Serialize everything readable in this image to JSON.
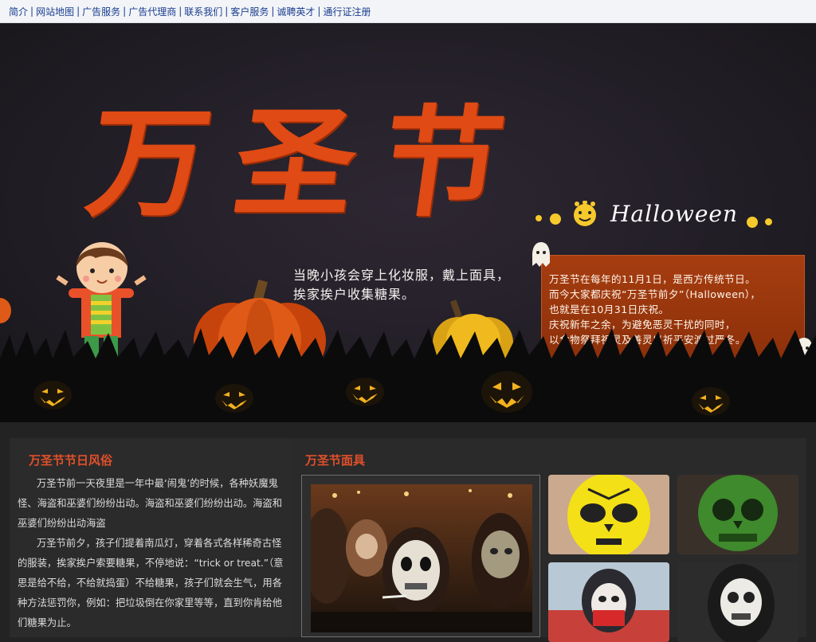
{
  "nav": {
    "items": [
      "简介",
      "网站地图",
      "广告服务",
      "广告代理商",
      "联系我们",
      "客户服务",
      "诚聘英才",
      "通行证注册"
    ],
    "separator": "|"
  },
  "banner": {
    "title": "万圣节",
    "halloween": "Halloween",
    "subtitle_line1": "当晚小孩会穿上化妆服，戴上面具，",
    "subtitle_line2": "挨家挨户收集糖果。",
    "box_lines": [
      "万圣节在每年的11月1日，是西方传统节日。",
      "而今大家都庆祝“万圣节前夕”（Halloween），",
      "也就是在10月31日庆祝。",
      "庆祝新年之余，为避免恶灵干扰的同时，",
      "以食物祭拜祖灵及善灵以祈平安渡过严冬。"
    ]
  },
  "customs": {
    "title": "万圣节节日风俗",
    "paragraph1": "万圣节前一天夜里是一年中最‘闹鬼’的时候，各种妖魔鬼怪、海盗和巫婆们纷纷出动。海盗和巫婆们纷纷出动。海盗和巫婆们纷纷出动海盗",
    "paragraph2": "万圣节前夕，孩子们提着南瓜灯，穿着各式各样稀奇古怪的服装，挨家挨户索要糖果，不停地说：“trick or treat.”（意思是给不给，不给就捣蛋）不给糖果，孩子们就会生气，用各种方法惩罚你，例如：把垃圾倒在你家里等等，直到你肯给他们糖果为止。"
  },
  "masks": {
    "title": "万圣节面具"
  },
  "colors": {
    "accent": "#e0502a",
    "title_orange": "#e04a14",
    "nav_link": "#1a3d8f",
    "page_bg": "#232323"
  }
}
